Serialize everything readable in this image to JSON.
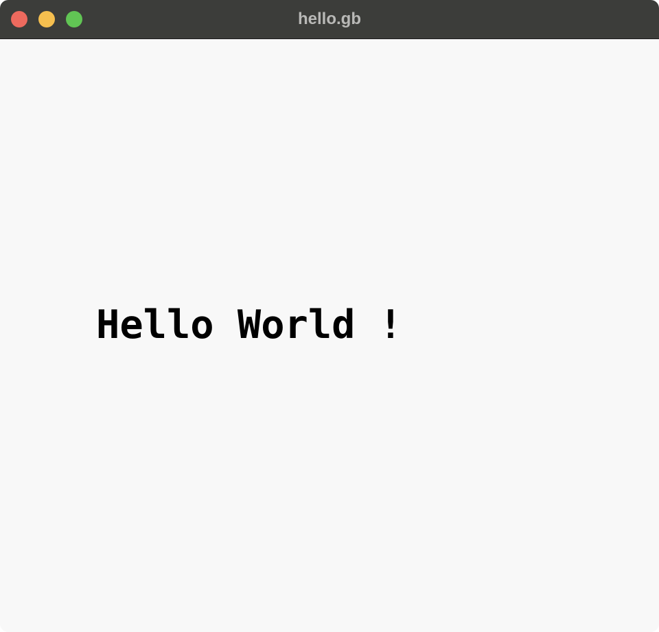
{
  "window": {
    "title": "hello.gb"
  },
  "screen": {
    "text": "Hello World !"
  },
  "colors": {
    "titlebar": "#3c3d3a",
    "title_text": "#b9b9b7",
    "screen_background": "#f8f8f8",
    "screen_text": "#000000",
    "close": "#ed6a5e",
    "minimize": "#f5bf4f",
    "zoom": "#61c554"
  }
}
